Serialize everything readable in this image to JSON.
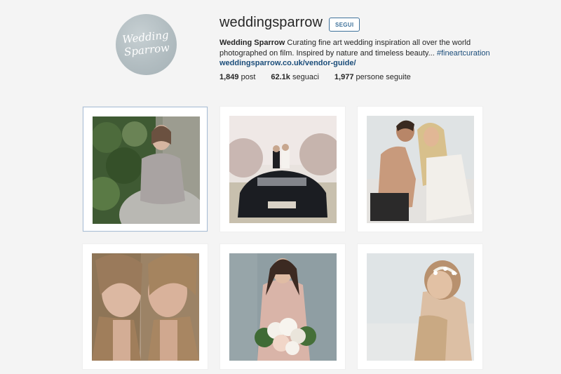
{
  "profile": {
    "avatar_text_line1": "Wedding",
    "avatar_text_line2": "Sparrow",
    "username": "weddingsparrow",
    "follow_label": "SEGUI",
    "bio_name": "Wedding Sparrow",
    "bio_text": " Curating fine art wedding inspiration all over the world photographed on film. Inspired by nature and timeless beauty... ",
    "bio_hashtag": "#fineartcuration",
    "website": "weddingsparrow.co.uk/vendor-guide/"
  },
  "stats": [
    {
      "value": "1,849",
      "label": " post"
    },
    {
      "value": "62.1k",
      "label": " seguaci"
    },
    {
      "value": "1,977",
      "label": " persone seguite"
    }
  ],
  "posts": [
    {
      "subject": "bride-ivy-wall"
    },
    {
      "subject": "couple-on-car"
    },
    {
      "subject": "couple-embrace-beach"
    },
    {
      "subject": "twin-portrait"
    },
    {
      "subject": "bride-bouquet"
    },
    {
      "subject": "bride-hairpiece-back"
    }
  ]
}
